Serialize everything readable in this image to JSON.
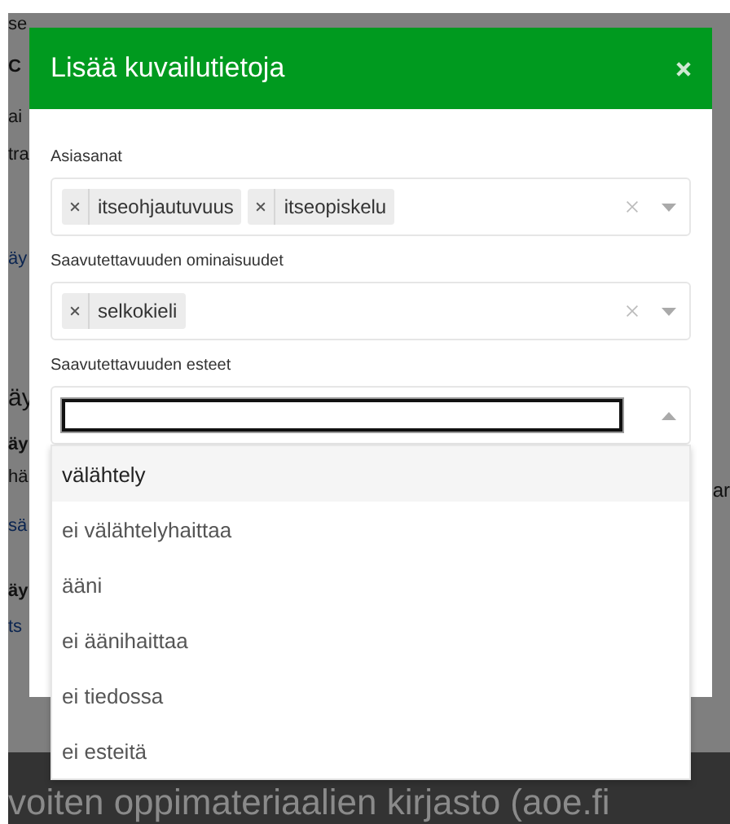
{
  "background": {
    "fragments_left": [
      {
        "text": "se",
        "kind": "text"
      },
      {
        "text": "C",
        "kind": "heading"
      },
      {
        "text": "ai",
        "kind": "text"
      },
      {
        "text": "tra",
        "kind": "text"
      },
      {
        "text": "äy",
        "kind": "link"
      },
      {
        "text": "äy",
        "kind": "title"
      },
      {
        "text": "äy",
        "kind": "heading"
      },
      {
        "text": "hä",
        "kind": "text"
      },
      {
        "text": "sä",
        "kind": "link"
      },
      {
        "text": "äy",
        "kind": "heading"
      },
      {
        "text": "ts",
        "kind": "link"
      }
    ],
    "fragment_right": "ar",
    "footer": "voiten oppimateriaalien kirjasto (aoe.fi"
  },
  "dialog": {
    "title": "Lisää kuvailutietoja",
    "fields": [
      {
        "label": "Asiasanat",
        "kind": "tags",
        "expanded": false,
        "tags": [
          "itseohjautuvuus",
          "itseopiskelu"
        ]
      },
      {
        "label": "Saavutettavuuden ominaisuudet",
        "kind": "tags",
        "expanded": false,
        "tags": [
          "selkokieli"
        ]
      },
      {
        "label": "Saavutettavuuden esteet",
        "kind": "search",
        "expanded": true,
        "options": [
          {
            "label": "välähtely",
            "selected": true
          },
          {
            "label": "ei välähtelyhaittaa",
            "selected": false
          },
          {
            "label": "ääni",
            "selected": false
          },
          {
            "label": "ei äänihaittaa",
            "selected": false
          },
          {
            "label": "ei tiedossa",
            "selected": false
          },
          {
            "label": "ei esteitä",
            "selected": false
          }
        ]
      }
    ]
  }
}
